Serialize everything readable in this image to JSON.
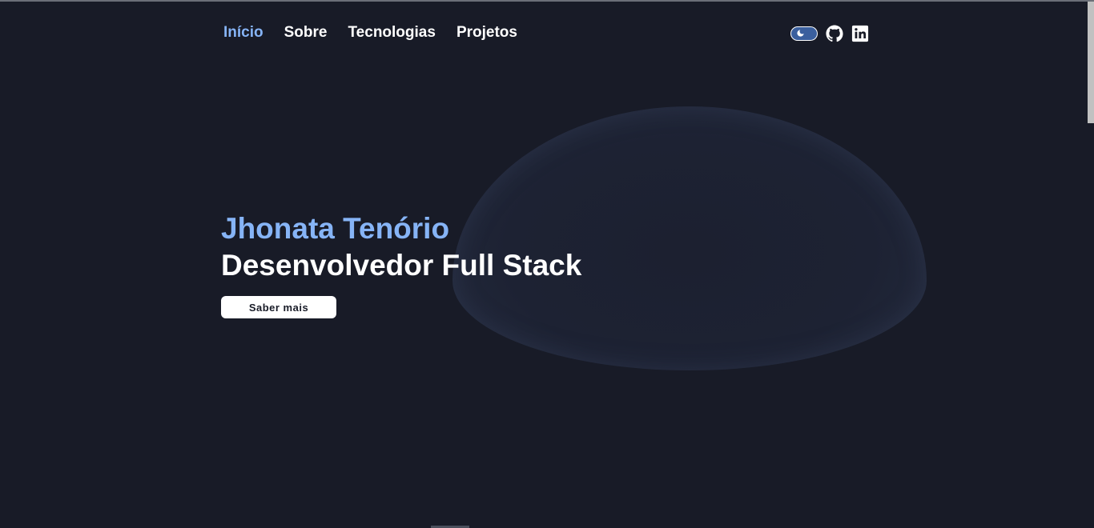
{
  "nav": {
    "items": [
      {
        "label": "Início",
        "active": true
      },
      {
        "label": "Sobre",
        "active": false
      },
      {
        "label": "Tecnologias",
        "active": false
      },
      {
        "label": "Projetos",
        "active": false
      }
    ]
  },
  "controls": {
    "theme_toggle": {
      "icon": "moon-icon",
      "state": "dark"
    },
    "icons": [
      "github-icon",
      "linkedin-icon"
    ]
  },
  "hero": {
    "name": "Jhonata Tenório",
    "role": "Desenvolvedor Full Stack",
    "cta_label": "Saber mais"
  },
  "colors": {
    "background": "#181b27",
    "accent": "#86b4f6",
    "text": "#ffffff",
    "toggle": "#3a5f9e"
  }
}
